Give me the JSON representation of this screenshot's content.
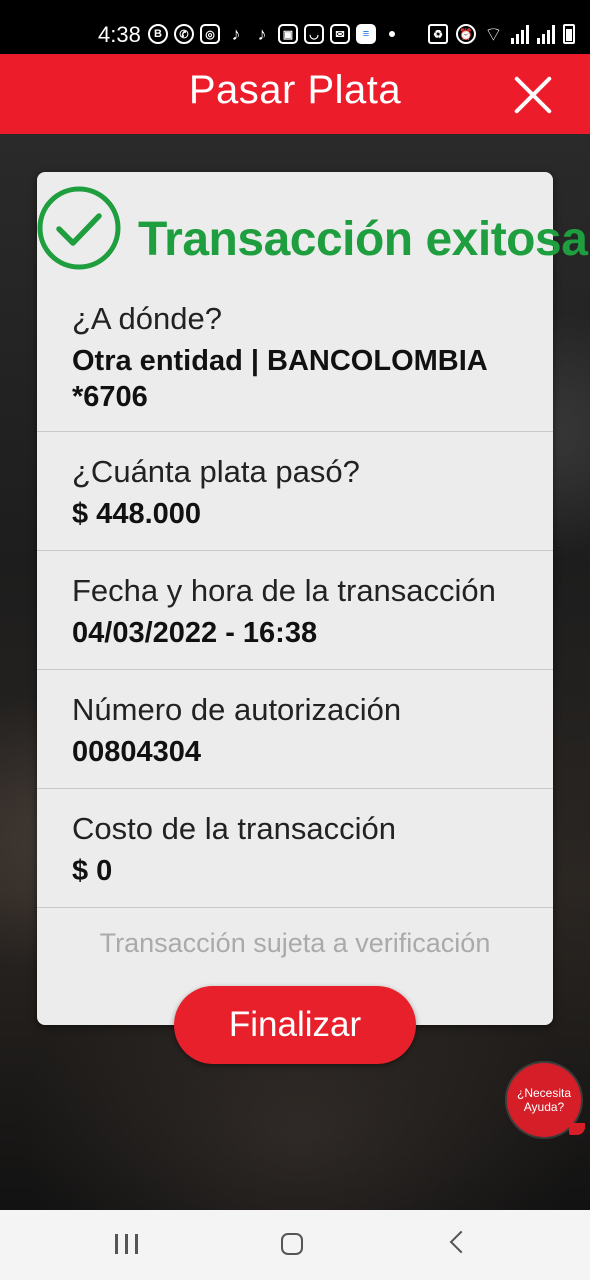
{
  "status_bar": {
    "time": "4:38",
    "left_icons": [
      "b-icon",
      "whatsapp-icon",
      "instagram-icon",
      "tiktok-icon",
      "tiktok-icon",
      "gallery-icon",
      "outlook-icon",
      "mail-icon",
      "docs-icon"
    ],
    "right_icons": [
      "battery-saver-icon",
      "alarm-icon",
      "wifi-icon",
      "signal-icon",
      "signal-icon",
      "battery-icon"
    ]
  },
  "header": {
    "title": "Pasar Plata",
    "color": "#ec1c2a"
  },
  "receipt": {
    "status_title": "Transacción exitosa",
    "status_color": "#1e9e3e",
    "destination_label": "¿A dónde?",
    "destination_value": "Otra entidad | BANCOLOMBIA *6706",
    "amount_label": "¿Cuánta plata pasó?",
    "amount_value": "$ 448.000",
    "datetime_label": "Fecha y hora de la transacción",
    "datetime_value": "04/03/2022 - 16:38",
    "auth_label": "Número de autorización",
    "auth_value": "00804304",
    "cost_label": "Costo de la transacción",
    "cost_value": "$ 0",
    "note": "Transacción sujeta a verificación"
  },
  "actions": {
    "finalize_label": "Finalizar"
  },
  "help": {
    "line1": "¿Necesita",
    "line2": "Ayuda?"
  }
}
